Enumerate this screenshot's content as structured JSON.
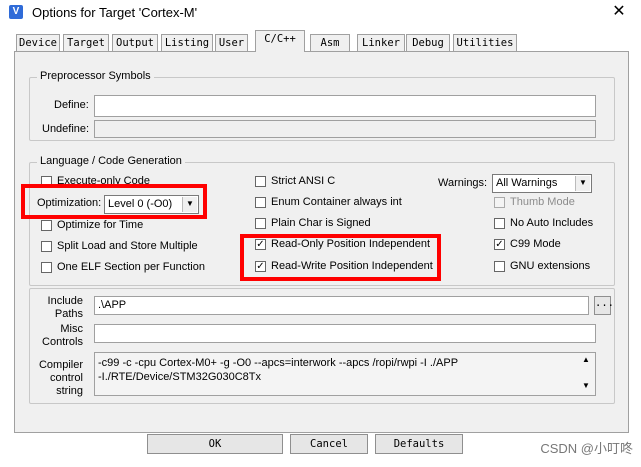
{
  "window": {
    "title": "Options for Target 'Cortex-M'",
    "app_icon": "V",
    "close_glyph": "✕"
  },
  "tabs": [
    {
      "label": "Device"
    },
    {
      "label": "Target"
    },
    {
      "label": "Output"
    },
    {
      "label": "Listing"
    },
    {
      "label": "User"
    },
    {
      "label": "C/C++",
      "active": true
    },
    {
      "label": "Asm"
    },
    {
      "label": "Linker"
    },
    {
      "label": "Debug"
    },
    {
      "label": "Utilities"
    }
  ],
  "preprocessor": {
    "legend": "Preprocessor Symbols",
    "define_label": "Define:",
    "define_value": "",
    "undefine_label": "Undefine:",
    "undefine_value": ""
  },
  "language": {
    "legend": "Language / Code Generation",
    "execute_only": {
      "label": "Execute-only Code",
      "checked": false
    },
    "optimization_label": "Optimization:",
    "optimization_value": "Level 0 (-O0)",
    "optimize_time": {
      "label": "Optimize for Time",
      "checked": false
    },
    "split_load": {
      "label": "Split Load and Store Multiple",
      "checked": false
    },
    "one_elf": {
      "label": "One ELF Section per Function",
      "checked": false
    },
    "strict_ansi": {
      "label": "Strict ANSI C",
      "checked": false
    },
    "enum_int": {
      "label": "Enum Container always int",
      "checked": false
    },
    "plain_char": {
      "label": "Plain Char is Signed",
      "checked": false
    },
    "ropi": {
      "label": "Read-Only Position Independent",
      "checked": true
    },
    "rwpi": {
      "label": "Read-Write Position Independent",
      "checked": true
    },
    "warnings_label": "Warnings:",
    "warnings_value": "All Warnings",
    "thumb_mode": {
      "label": "Thumb Mode",
      "checked": false,
      "disabled": true
    },
    "no_auto_includes": {
      "label": "No Auto Includes",
      "checked": false
    },
    "c99_mode": {
      "label": "C99 Mode",
      "checked": true
    },
    "gnu_ext": {
      "label": "GNU extensions",
      "checked": false
    }
  },
  "include": {
    "label_line1": "Include",
    "label_line2": "Paths",
    "value": ".\\APP",
    "browse": "..."
  },
  "misc": {
    "label_line1": "Misc",
    "label_line2": "Controls",
    "value": ""
  },
  "compiler": {
    "label_line1": "Compiler",
    "label_line2": "control",
    "label_line3": "string",
    "line1": "-c99 -c -cpu Cortex-M0+ -g -O0 --apcs=interwork --apcs /ropi/rwpi -I ./APP",
    "line2": "-I./RTE/Device/STM32G030C8Tx"
  },
  "buttons": {
    "ok": "OK",
    "cancel": "Cancel",
    "defaults": "Defaults"
  },
  "watermark": "CSDN @小叮咚",
  "colors": {
    "highlight": "#ff0000",
    "dialog_bg": "#f0f0f0"
  }
}
